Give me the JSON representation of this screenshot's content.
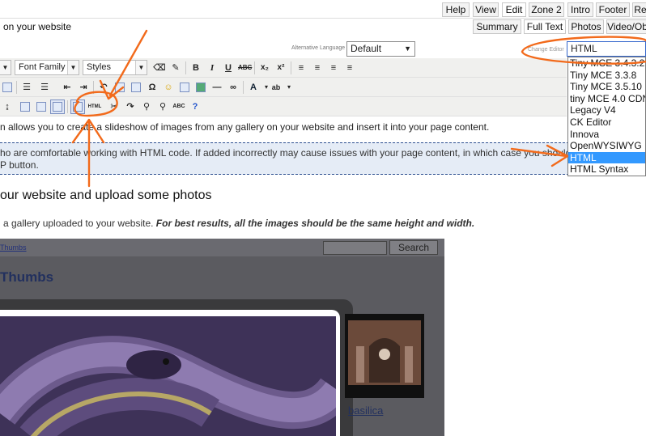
{
  "top_tabs": [
    "Help",
    "View",
    "Edit",
    "Zone 2",
    "Intro",
    "Footer",
    "Re"
  ],
  "page_subtitle": "on your website",
  "content_tabs": [
    "Summary",
    "Full Text",
    "Photos",
    "Video/Ob"
  ],
  "alt_language": {
    "label": "Alternative Language",
    "value": "Default"
  },
  "editor": {
    "label": "Change Editor",
    "value": "HTML"
  },
  "toolbar": {
    "font_family": "Font Family",
    "styles": "Styles",
    "bold": "B",
    "italic": "I",
    "underline": "U",
    "strike": "ABC",
    "subscript": "x₂",
    "superscript": "x²",
    "omega": "Ω",
    "smiley": "☺",
    "html_btn": "HTML"
  },
  "paragraph1": "n allows you to create a slideshow of images from any gallery on your website and insert it into your page content.",
  "notice_line1": "ho are comfortable working with HTML code. If added incorrectly may cause issues with your page content, in which case you should",
  "notice_line2": "P button.",
  "heading": "our website and upload some photos",
  "hint_plain": "a gallery uploaded to your website.",
  "hint_bold": "For best results, all the images should be the same height and width.",
  "gallery": {
    "breadcrumb": "Thumbs",
    "search_button": "Search",
    "title": "Thumbs",
    "caption": "basilica"
  },
  "editor_options": [
    "Tiny MCE 3.4.3.2",
    "Tiny MCE 3.3.8",
    "Tiny MCE 3.5.10",
    "tiny MCE 4.0 CDN",
    "Legacy V4",
    "CK Editor",
    "Innova",
    "OpenWYSIWYG",
    "HTML",
    "HTML Syntax"
  ],
  "editor_selected": "HTML",
  "colors": {
    "highlight": "#3399ff",
    "annotation": "#f26a1b",
    "notice_bg": "#e5ecf6"
  }
}
